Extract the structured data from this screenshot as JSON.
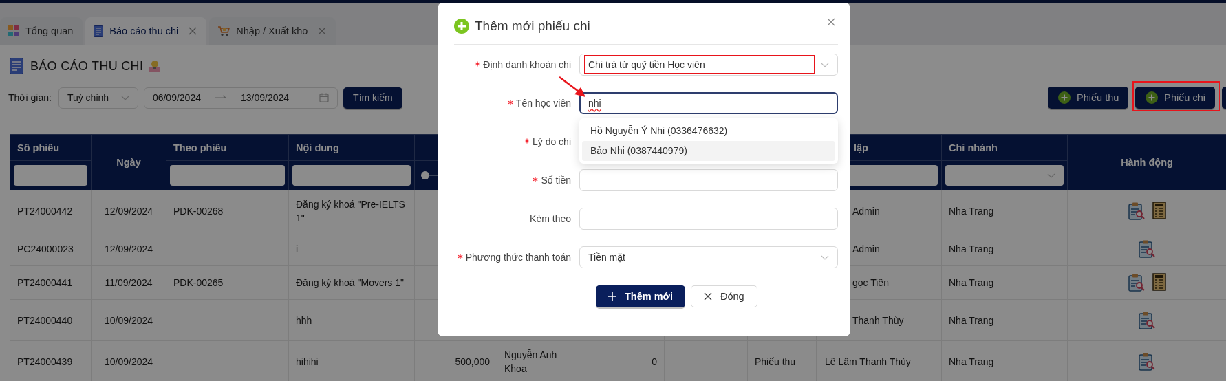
{
  "tabs": [
    {
      "label": "Tổng quan",
      "selected": false,
      "closable": false
    },
    {
      "label": "Báo cáo thu chi",
      "selected": true,
      "closable": true
    },
    {
      "label": "Nhập / Xuất kho",
      "selected": false,
      "closable": true
    }
  ],
  "page_title": "BÁO CÁO THU CHI",
  "filters": {
    "period_label": "Thời gian:",
    "period_value": "Tuỳ chỉnh",
    "date_from": "06/09/2024",
    "date_to": "13/09/2024",
    "search_button": "Tìm kiếm"
  },
  "toolbar_buttons": [
    {
      "label": "Phiếu thu",
      "highlighted": false
    },
    {
      "label": "Phiếu chi",
      "highlighted": true
    }
  ],
  "table": {
    "columns": [
      {
        "label": "Số phiếu",
        "kind": "text"
      },
      {
        "label": "Ngày",
        "kind": "none"
      },
      {
        "label": "Theo phiếu",
        "kind": "text"
      },
      {
        "label": "Nội dung",
        "kind": "text"
      },
      {
        "kind": "range",
        "level": 0
      },
      null,
      null,
      null,
      null,
      {
        "label": "lập",
        "kind": "text"
      },
      {
        "label": "Chi nhánh",
        "kind": "select"
      },
      {
        "label": "Hành động",
        "kind": "none"
      }
    ],
    "rows": [
      {
        "cells": [
          "PT24000442",
          "12/09/2024",
          "PDK-00268",
          "Đăng ký khoá \"Pre-IELTS 1\"",
          null,
          null,
          null,
          null,
          null,
          "Admin",
          "Nha Trang"
        ],
        "actions": [
          {
            "kind": "view"
          },
          {
            "kind": "info"
          }
        ]
      },
      {
        "cells": [
          "PC24000023",
          "12/09/2024",
          null,
          "i",
          null,
          null,
          null,
          null,
          null,
          "Admin",
          "Nha Trang"
        ],
        "actions": [
          {
            "kind": "view"
          }
        ]
      },
      {
        "cells": [
          "PT24000441",
          "11/09/2024",
          "PDK-00265",
          "Đăng ký khoá \"Movers 1\"",
          null,
          null,
          null,
          null,
          null,
          "gọc Tiên",
          "Nha Trang"
        ],
        "actions": [
          {
            "kind": "view"
          },
          {
            "kind": "info"
          }
        ]
      },
      {
        "cells": [
          "PT24000440",
          "10/09/2024",
          null,
          "hhh",
          null,
          null,
          null,
          null,
          null,
          "Thanh Thùy",
          "Nha Trang"
        ],
        "actions": [
          {
            "kind": "view"
          }
        ]
      },
      {
        "cells": [
          "PT24000439",
          "10/09/2024",
          null,
          "hihihi",
          "500,000",
          "Nguyễn Anh Khoa",
          "0",
          null,
          "Phiếu thu",
          "Lê Lâm Thanh Thùy",
          "Nha Trang"
        ],
        "actions": [
          {
            "kind": "view"
          }
        ]
      }
    ]
  },
  "modal": {
    "title": "Thêm mới phiếu chi",
    "fields": [
      {
        "label": "Định danh khoản chi",
        "required": true,
        "kind": "select",
        "value": "Chi trả từ quỹ tiền Học viên",
        "focused": false,
        "highlighted": true,
        "pointed_at": false
      },
      {
        "label": "Tên học viên",
        "required": true,
        "kind": "search",
        "value": "nhi",
        "misspelled": true,
        "focused": true,
        "highlighted": false,
        "pointed_at": true,
        "suggestions": [
          {
            "label": "Hồ Nguyễn Ý Nhi (0336476632)",
            "selected": false
          },
          {
            "label": "Bảo Nhi (0387440979)",
            "selected": true
          }
        ]
      },
      {
        "label": "Lý do chi",
        "required": true
      },
      {
        "label": "Số tiền",
        "required": true,
        "kind": "text",
        "focused": false,
        "highlighted": false,
        "pointed_at": false
      },
      {
        "label": "Kèm theo",
        "required": false,
        "kind": "text",
        "focused": false,
        "highlighted": false,
        "pointed_at": false
      },
      {
        "label": "Phương thức thanh toán",
        "required": true,
        "kind": "select",
        "value": "Tiền mặt",
        "focused": false,
        "highlighted": false,
        "pointed_at": false
      }
    ],
    "buttons": [
      {
        "label": "Thêm mới",
        "kind": "primary"
      },
      {
        "label": "Đóng",
        "kind": "close"
      }
    ]
  }
}
